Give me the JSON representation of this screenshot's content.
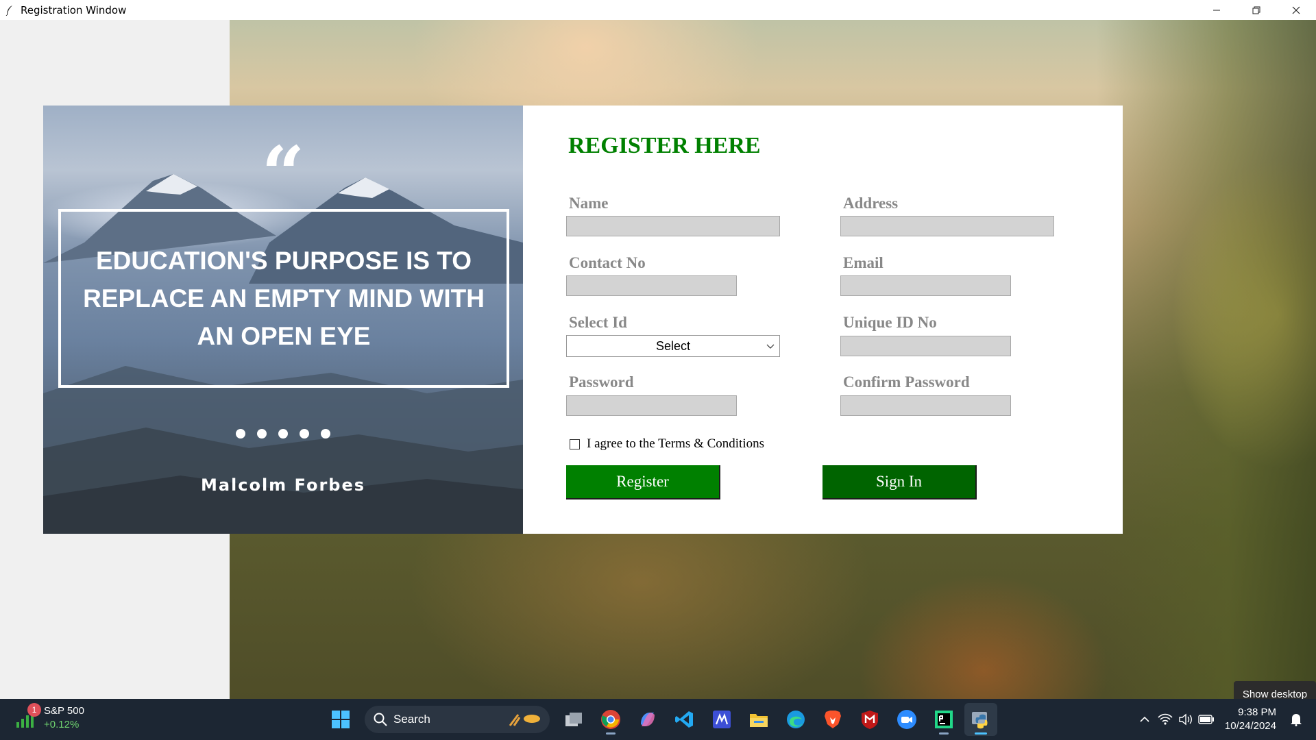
{
  "window": {
    "title": "Registration Window",
    "controls": [
      "minimize",
      "restore",
      "close"
    ]
  },
  "quote": {
    "mark": "“",
    "text": "EDUCATION'S PURPOSE IS TO REPLACE AN EMPTY MIND WITH AN OPEN EYE",
    "author": "Malcolm Forbes",
    "dot_count": 5
  },
  "form": {
    "title": "REGISTER HERE",
    "fields": {
      "name": {
        "label": "Name",
        "value": ""
      },
      "address": {
        "label": "Address",
        "value": ""
      },
      "contact": {
        "label": "Contact No",
        "value": ""
      },
      "email": {
        "label": "Email",
        "value": ""
      },
      "select_id": {
        "label": "Select Id",
        "value": "Select"
      },
      "unique_id": {
        "label": "Unique ID No",
        "value": ""
      },
      "password": {
        "label": "Password",
        "value": ""
      },
      "confirm_password": {
        "label": "Confirm Password",
        "value": ""
      }
    },
    "terms_label": "I agree to the Terms & Conditions",
    "terms_checked": false,
    "register_label": "Register",
    "signin_label": "Sign In",
    "colors": {
      "title": "#008000",
      "register": "#008000",
      "signin": "#006400",
      "label": "#888888",
      "input_bg": "#d3d3d3"
    }
  },
  "tooltip": {
    "text": "Show desktop"
  },
  "taskbar": {
    "stock": {
      "name": "S&P 500",
      "change": "+0.12%",
      "badge": "1"
    },
    "search_label": "Search",
    "apps": [
      "task-view",
      "chrome",
      "copilot",
      "vscode",
      "mathpix",
      "file-explorer",
      "edge",
      "brave",
      "mcafee",
      "zoom",
      "pycharm",
      "python"
    ],
    "clock": {
      "time": "9:38 PM",
      "date": "10/24/2024"
    }
  }
}
